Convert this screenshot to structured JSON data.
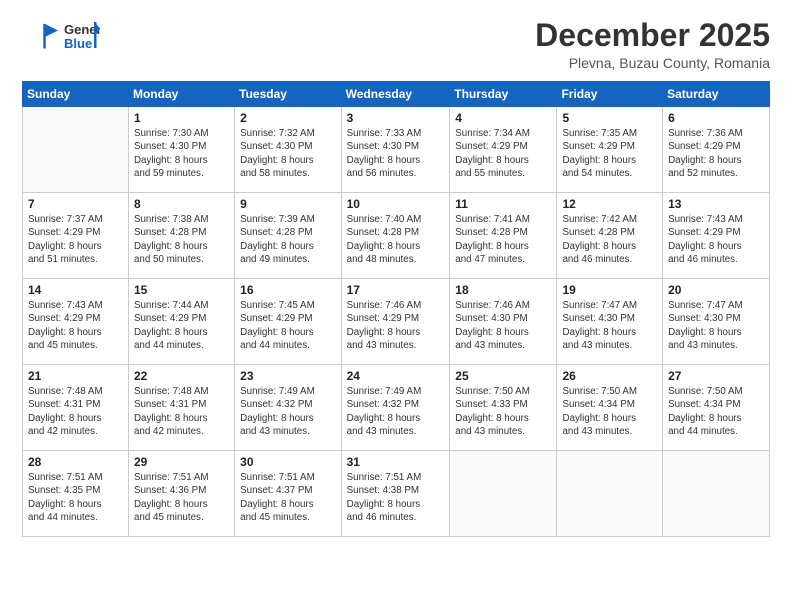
{
  "logo": {
    "line1": "General",
    "line2": "Blue"
  },
  "title": "December 2025",
  "subtitle": "Plevna, Buzau County, Romania",
  "days_of_week": [
    "Sunday",
    "Monday",
    "Tuesday",
    "Wednesday",
    "Thursday",
    "Friday",
    "Saturday"
  ],
  "weeks": [
    [
      {
        "day": "",
        "info": ""
      },
      {
        "day": "1",
        "info": "Sunrise: 7:30 AM\nSunset: 4:30 PM\nDaylight: 8 hours\nand 59 minutes."
      },
      {
        "day": "2",
        "info": "Sunrise: 7:32 AM\nSunset: 4:30 PM\nDaylight: 8 hours\nand 58 minutes."
      },
      {
        "day": "3",
        "info": "Sunrise: 7:33 AM\nSunset: 4:30 PM\nDaylight: 8 hours\nand 56 minutes."
      },
      {
        "day": "4",
        "info": "Sunrise: 7:34 AM\nSunset: 4:29 PM\nDaylight: 8 hours\nand 55 minutes."
      },
      {
        "day": "5",
        "info": "Sunrise: 7:35 AM\nSunset: 4:29 PM\nDaylight: 8 hours\nand 54 minutes."
      },
      {
        "day": "6",
        "info": "Sunrise: 7:36 AM\nSunset: 4:29 PM\nDaylight: 8 hours\nand 52 minutes."
      }
    ],
    [
      {
        "day": "7",
        "info": "Sunrise: 7:37 AM\nSunset: 4:29 PM\nDaylight: 8 hours\nand 51 minutes."
      },
      {
        "day": "8",
        "info": "Sunrise: 7:38 AM\nSunset: 4:28 PM\nDaylight: 8 hours\nand 50 minutes."
      },
      {
        "day": "9",
        "info": "Sunrise: 7:39 AM\nSunset: 4:28 PM\nDaylight: 8 hours\nand 49 minutes."
      },
      {
        "day": "10",
        "info": "Sunrise: 7:40 AM\nSunset: 4:28 PM\nDaylight: 8 hours\nand 48 minutes."
      },
      {
        "day": "11",
        "info": "Sunrise: 7:41 AM\nSunset: 4:28 PM\nDaylight: 8 hours\nand 47 minutes."
      },
      {
        "day": "12",
        "info": "Sunrise: 7:42 AM\nSunset: 4:28 PM\nDaylight: 8 hours\nand 46 minutes."
      },
      {
        "day": "13",
        "info": "Sunrise: 7:43 AM\nSunset: 4:29 PM\nDaylight: 8 hours\nand 46 minutes."
      }
    ],
    [
      {
        "day": "14",
        "info": "Sunrise: 7:43 AM\nSunset: 4:29 PM\nDaylight: 8 hours\nand 45 minutes."
      },
      {
        "day": "15",
        "info": "Sunrise: 7:44 AM\nSunset: 4:29 PM\nDaylight: 8 hours\nand 44 minutes."
      },
      {
        "day": "16",
        "info": "Sunrise: 7:45 AM\nSunset: 4:29 PM\nDaylight: 8 hours\nand 44 minutes."
      },
      {
        "day": "17",
        "info": "Sunrise: 7:46 AM\nSunset: 4:29 PM\nDaylight: 8 hours\nand 43 minutes."
      },
      {
        "day": "18",
        "info": "Sunrise: 7:46 AM\nSunset: 4:30 PM\nDaylight: 8 hours\nand 43 minutes."
      },
      {
        "day": "19",
        "info": "Sunrise: 7:47 AM\nSunset: 4:30 PM\nDaylight: 8 hours\nand 43 minutes."
      },
      {
        "day": "20",
        "info": "Sunrise: 7:47 AM\nSunset: 4:30 PM\nDaylight: 8 hours\nand 43 minutes."
      }
    ],
    [
      {
        "day": "21",
        "info": "Sunrise: 7:48 AM\nSunset: 4:31 PM\nDaylight: 8 hours\nand 42 minutes."
      },
      {
        "day": "22",
        "info": "Sunrise: 7:48 AM\nSunset: 4:31 PM\nDaylight: 8 hours\nand 42 minutes."
      },
      {
        "day": "23",
        "info": "Sunrise: 7:49 AM\nSunset: 4:32 PM\nDaylight: 8 hours\nand 43 minutes."
      },
      {
        "day": "24",
        "info": "Sunrise: 7:49 AM\nSunset: 4:32 PM\nDaylight: 8 hours\nand 43 minutes."
      },
      {
        "day": "25",
        "info": "Sunrise: 7:50 AM\nSunset: 4:33 PM\nDaylight: 8 hours\nand 43 minutes."
      },
      {
        "day": "26",
        "info": "Sunrise: 7:50 AM\nSunset: 4:34 PM\nDaylight: 8 hours\nand 43 minutes."
      },
      {
        "day": "27",
        "info": "Sunrise: 7:50 AM\nSunset: 4:34 PM\nDaylight: 8 hours\nand 44 minutes."
      }
    ],
    [
      {
        "day": "28",
        "info": "Sunrise: 7:51 AM\nSunset: 4:35 PM\nDaylight: 8 hours\nand 44 minutes."
      },
      {
        "day": "29",
        "info": "Sunrise: 7:51 AM\nSunset: 4:36 PM\nDaylight: 8 hours\nand 45 minutes."
      },
      {
        "day": "30",
        "info": "Sunrise: 7:51 AM\nSunset: 4:37 PM\nDaylight: 8 hours\nand 45 minutes."
      },
      {
        "day": "31",
        "info": "Sunrise: 7:51 AM\nSunset: 4:38 PM\nDaylight: 8 hours\nand 46 minutes."
      },
      {
        "day": "",
        "info": ""
      },
      {
        "day": "",
        "info": ""
      },
      {
        "day": "",
        "info": ""
      }
    ]
  ]
}
